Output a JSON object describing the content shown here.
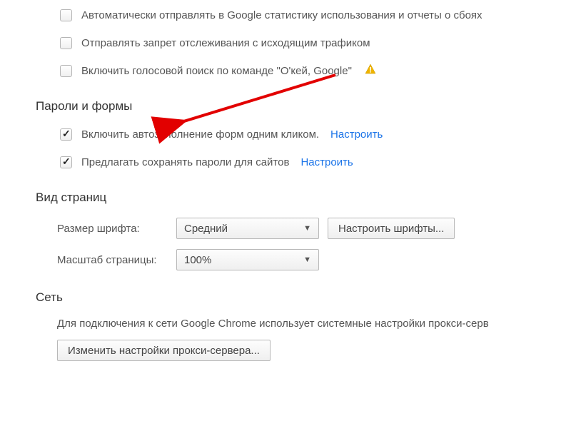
{
  "privacy": {
    "opt_stats_label": "Автоматически отправлять в Google статистику использования и отчеты о сбоях",
    "opt_dnt_label": "Отправлять запрет отслеживания с исходящим трафиком",
    "opt_voice_label": "Включить голосовой поиск по команде \"О'кей, Google\""
  },
  "passwords": {
    "title": "Пароли и формы",
    "opt_autofill_label": "Включить автозаполнение форм одним кликом.",
    "opt_autofill_link": "Настроить",
    "opt_savepass_label": "Предлагать сохранять пароли для сайтов",
    "opt_savepass_link": "Настроить"
  },
  "appearance": {
    "title": "Вид страниц",
    "font_label": "Размер шрифта:",
    "font_value": "Средний",
    "customize_fonts_btn": "Настроить шрифты...",
    "zoom_label": "Масштаб страницы:",
    "zoom_value": "100%"
  },
  "network": {
    "title": "Сеть",
    "desc": "Для подключения к сети Google Chrome использует системные настройки прокси-серв",
    "proxy_btn": "Изменить настройки прокси-сервера..."
  }
}
